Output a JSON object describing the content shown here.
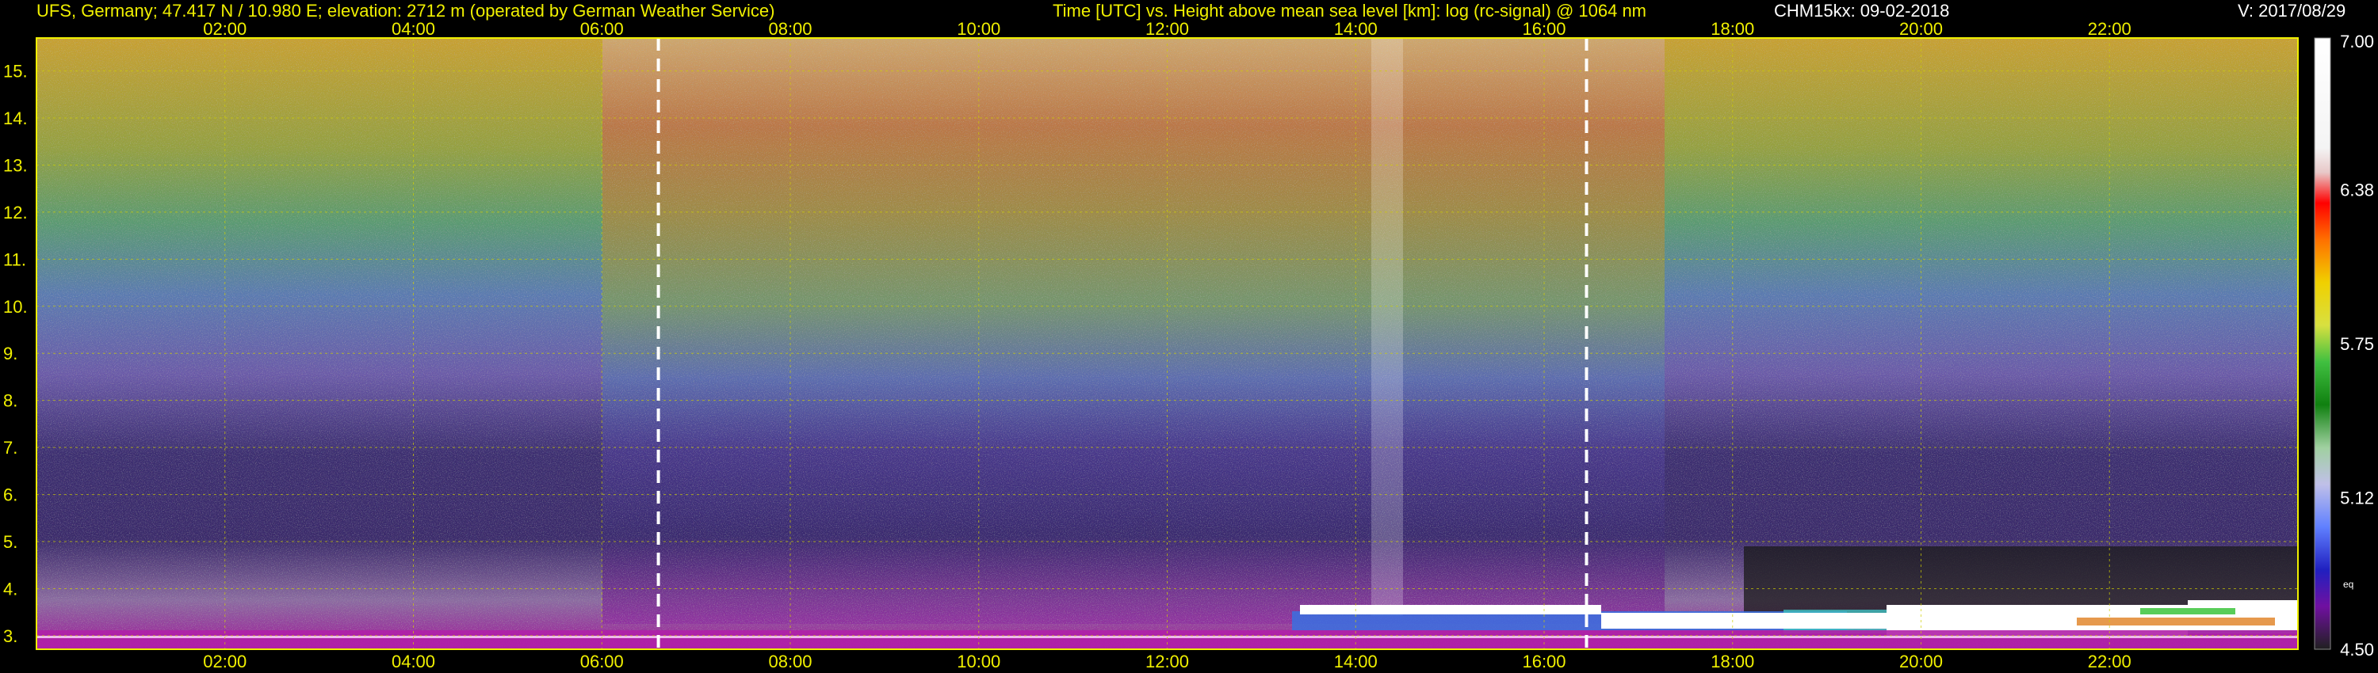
{
  "header": {
    "site_info": "UFS, Germany; 47.417 N / 10.980 E; elevation: 2712 m  (operated by German Weather Service)",
    "axis_info": "Time [UTC] vs. Height above mean sea level [km]: log (rc-signal) @ 1064 nm",
    "instrument_date": "CHM15kx: 09-02-2018",
    "version": "V: 2017/08/29"
  },
  "colors": {
    "label_text": "#f0f000",
    "grid": "#d0d000",
    "marker_line": "#ffffff",
    "background": "#000000"
  },
  "chart_data": {
    "type": "heatmap",
    "title": "Time [UTC] vs. Height above mean sea level [km]: log (rc-signal) @ 1064 nm",
    "xlabel": "Time [UTC]",
    "ylabel": "Height above mean sea level [km]",
    "x_ticks": [
      "02:00",
      "04:00",
      "06:00",
      "08:00",
      "10:00",
      "12:00",
      "14:00",
      "16:00",
      "18:00",
      "20:00",
      "22:00"
    ],
    "x_tick_hours": [
      2,
      4,
      6,
      8,
      10,
      12,
      14,
      16,
      18,
      20,
      22
    ],
    "xlim_hours": [
      0,
      24
    ],
    "y_ticks": [
      "3.",
      "4.",
      "5.",
      "6.",
      "7.",
      "8.",
      "9.",
      "10.",
      "11.",
      "12.",
      "13.",
      "14.",
      "15."
    ],
    "y_tick_values": [
      3,
      4,
      5,
      6,
      7,
      8,
      9,
      10,
      11,
      12,
      13,
      14,
      15
    ],
    "ylim": [
      2.712,
      15.7
    ],
    "vertical_markers_hours": [
      6.6,
      16.45
    ],
    "colorbar": {
      "range": [
        4.5,
        7.0
      ],
      "tick_labels": [
        "7.00",
        "6.38",
        "5.75",
        "5.12",
        "4.50"
      ],
      "tick_values": [
        7.0,
        6.38,
        5.75,
        5.12,
        4.5
      ],
      "eq_label": "eq"
    },
    "grid": true
  }
}
